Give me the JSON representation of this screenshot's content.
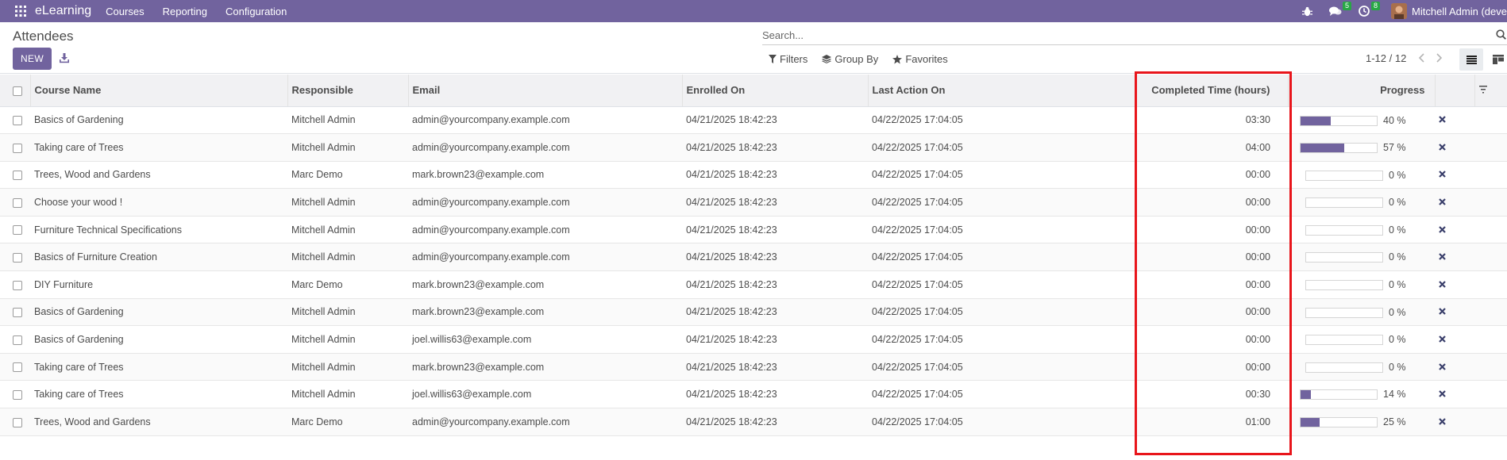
{
  "navbar": {
    "app_name": "eLearning",
    "menu": [
      "Courses",
      "Reporting",
      "Configuration"
    ],
    "messages_count": "5",
    "activities_count": "8",
    "user_name": "Mitchell Admin (deve"
  },
  "control": {
    "title": "Attendees",
    "new_label": "NEW",
    "search_placeholder": "Search...",
    "filters_label": "Filters",
    "groupby_label": "Group By",
    "favorites_label": "Favorites",
    "pager": "1-12 / 12"
  },
  "table": {
    "headers": {
      "course": "Course Name",
      "responsible": "Responsible",
      "email": "Email",
      "enrolled": "Enrolled On",
      "last_action": "Last Action On",
      "completed": "Completed Time (hours)",
      "progress": "Progress"
    },
    "rows": [
      {
        "course": "Basics of Gardening",
        "responsible": "Mitchell Admin",
        "email": "admin@yourcompany.example.com",
        "enrolled": "04/21/2025 18:42:23",
        "last_action": "04/22/2025 17:04:05",
        "completed": "03:30",
        "progress": 40,
        "progress_label": "40 %"
      },
      {
        "course": "Taking care of Trees",
        "responsible": "Mitchell Admin",
        "email": "admin@yourcompany.example.com",
        "enrolled": "04/21/2025 18:42:23",
        "last_action": "04/22/2025 17:04:05",
        "completed": "04:00",
        "progress": 57,
        "progress_label": "57 %"
      },
      {
        "course": "Trees, Wood and Gardens",
        "responsible": "Marc Demo",
        "email": "mark.brown23@example.com",
        "enrolled": "04/21/2025 18:42:23",
        "last_action": "04/22/2025 17:04:05",
        "completed": "00:00",
        "progress": 0,
        "progress_label": "0 %"
      },
      {
        "course": "Choose your wood !",
        "responsible": "Mitchell Admin",
        "email": "admin@yourcompany.example.com",
        "enrolled": "04/21/2025 18:42:23",
        "last_action": "04/22/2025 17:04:05",
        "completed": "00:00",
        "progress": 0,
        "progress_label": "0 %"
      },
      {
        "course": "Furniture Technical Specifications",
        "responsible": "Mitchell Admin",
        "email": "admin@yourcompany.example.com",
        "enrolled": "04/21/2025 18:42:23",
        "last_action": "04/22/2025 17:04:05",
        "completed": "00:00",
        "progress": 0,
        "progress_label": "0 %"
      },
      {
        "course": "Basics of Furniture Creation",
        "responsible": "Mitchell Admin",
        "email": "admin@yourcompany.example.com",
        "enrolled": "04/21/2025 18:42:23",
        "last_action": "04/22/2025 17:04:05",
        "completed": "00:00",
        "progress": 0,
        "progress_label": "0 %"
      },
      {
        "course": "DIY Furniture",
        "responsible": "Marc Demo",
        "email": "mark.brown23@example.com",
        "enrolled": "04/21/2025 18:42:23",
        "last_action": "04/22/2025 17:04:05",
        "completed": "00:00",
        "progress": 0,
        "progress_label": "0 %"
      },
      {
        "course": "Basics of Gardening",
        "responsible": "Mitchell Admin",
        "email": "mark.brown23@example.com",
        "enrolled": "04/21/2025 18:42:23",
        "last_action": "04/22/2025 17:04:05",
        "completed": "00:00",
        "progress": 0,
        "progress_label": "0 %"
      },
      {
        "course": "Basics of Gardening",
        "responsible": "Mitchell Admin",
        "email": "joel.willis63@example.com",
        "enrolled": "04/21/2025 18:42:23",
        "last_action": "04/22/2025 17:04:05",
        "completed": "00:00",
        "progress": 0,
        "progress_label": "0 %"
      },
      {
        "course": "Taking care of Trees",
        "responsible": "Mitchell Admin",
        "email": "mark.brown23@example.com",
        "enrolled": "04/21/2025 18:42:23",
        "last_action": "04/22/2025 17:04:05",
        "completed": "00:00",
        "progress": 0,
        "progress_label": "0 %"
      },
      {
        "course": "Taking care of Trees",
        "responsible": "Mitchell Admin",
        "email": "joel.willis63@example.com",
        "enrolled": "04/21/2025 18:42:23",
        "last_action": "04/22/2025 17:04:05",
        "completed": "00:30",
        "progress": 14,
        "progress_label": "14 %"
      },
      {
        "course": "Trees, Wood and Gardens",
        "responsible": "Marc Demo",
        "email": "admin@yourcompany.example.com",
        "enrolled": "04/21/2025 18:42:23",
        "last_action": "04/22/2025 17:04:05",
        "completed": "01:00",
        "progress": 25,
        "progress_label": "25 %"
      }
    ]
  },
  "colors": {
    "brand": "#71639e",
    "highlight": "#e8151b",
    "badge": "#28a745"
  },
  "icons": {
    "apps": "apps-grid-icon",
    "bug": "bug-icon",
    "chat": "chat-icon",
    "clock": "clock-icon",
    "download": "download-icon",
    "search": "search-icon",
    "filter": "filter-icon",
    "groupby": "layers-icon",
    "favorite": "star-icon",
    "list_view": "list-view-icon",
    "kanban_view": "kanban-view-icon",
    "remove": "close-icon"
  }
}
